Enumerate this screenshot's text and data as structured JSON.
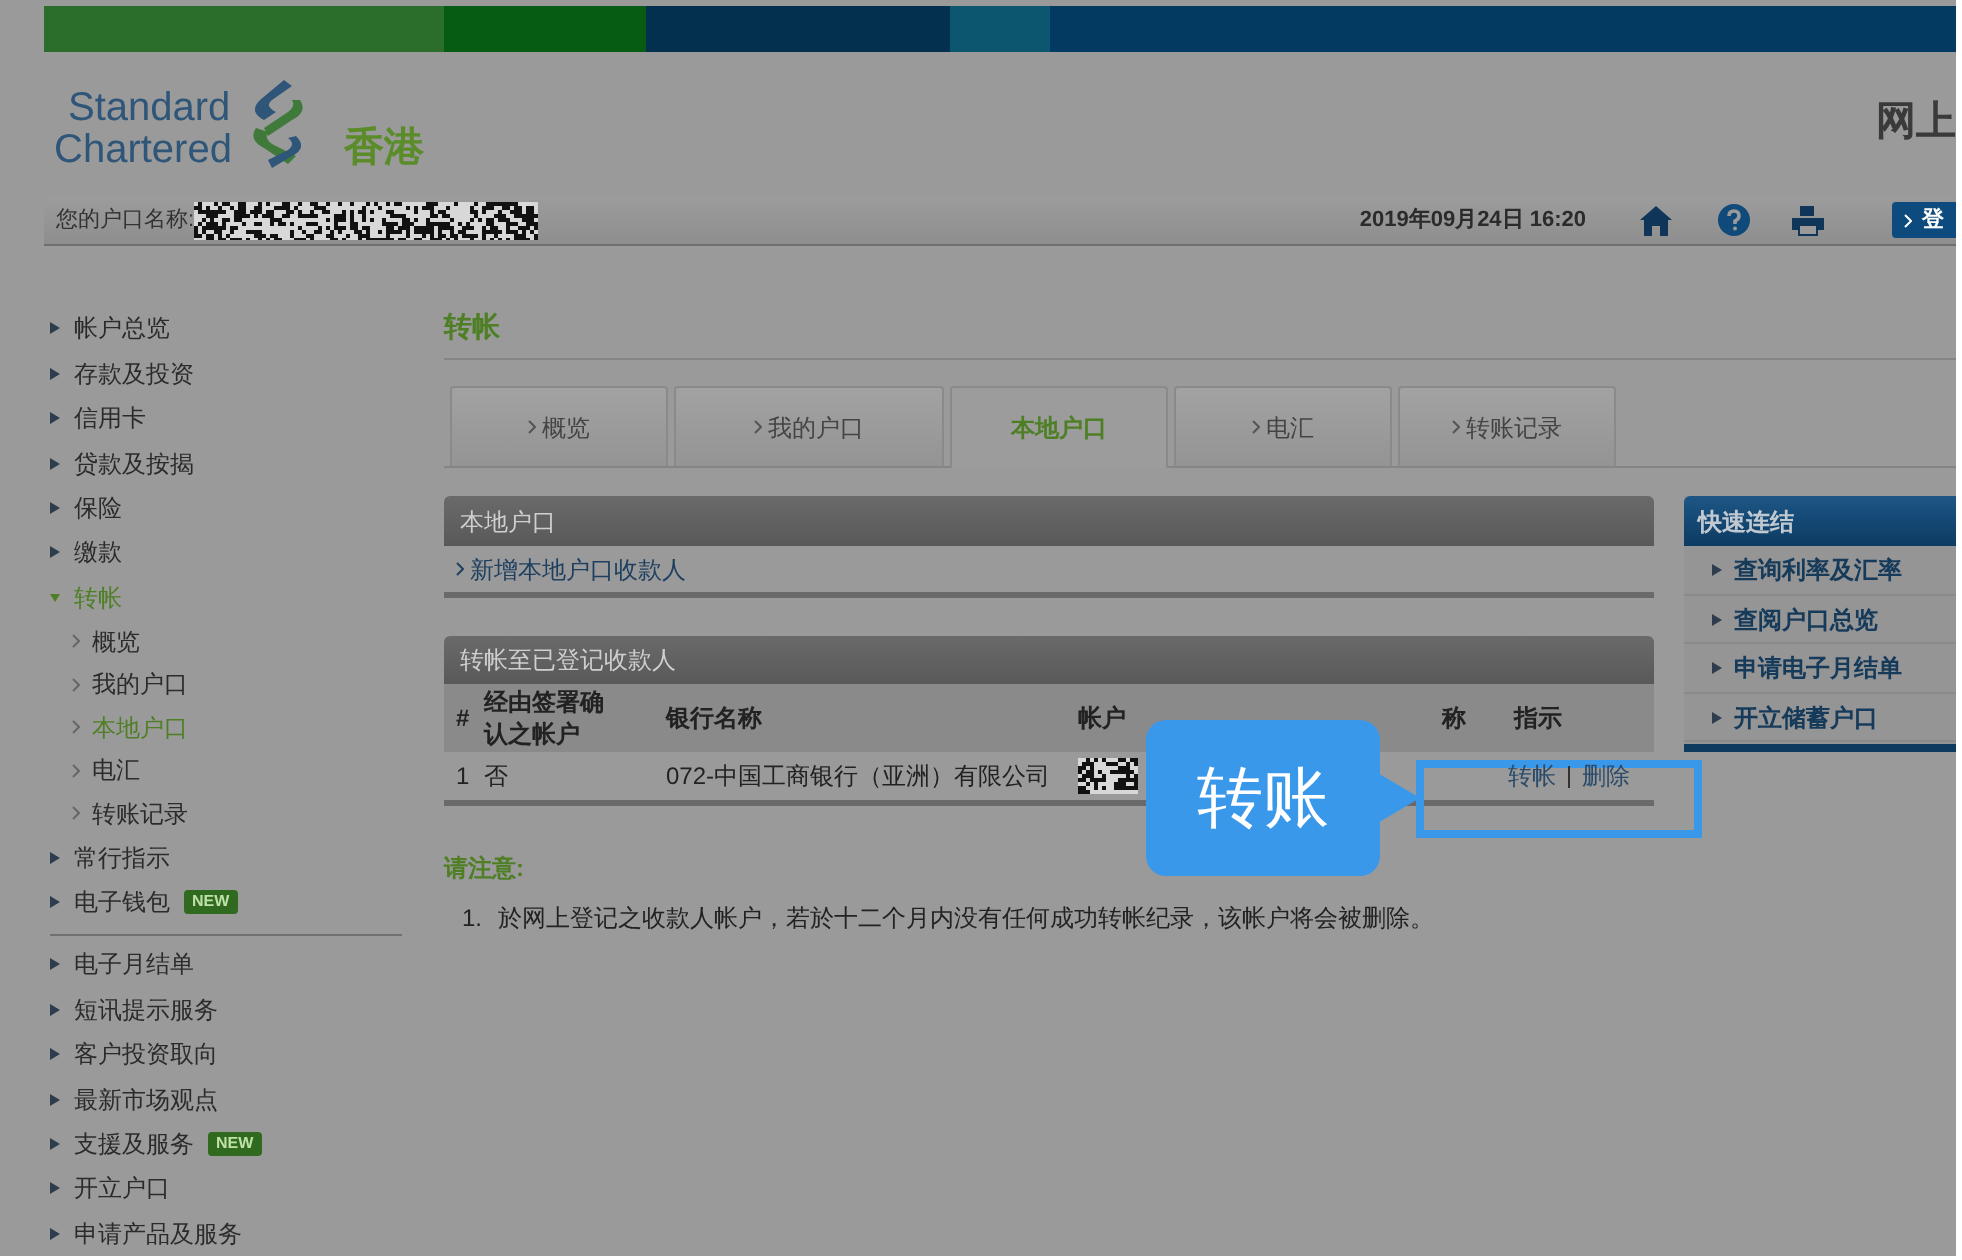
{
  "logo": {
    "line1": "Standard",
    "line2": "Chartered",
    "region": "香港"
  },
  "header_title": "网上",
  "account_bar": {
    "label": "您的户口名称:",
    "datetime": "2019年09月24日 16:20",
    "login_button": "登"
  },
  "sidebar": {
    "sections": [
      [
        {
          "label": "帐户总览",
          "expanded": false
        },
        {
          "label": "存款及投资",
          "expanded": false
        },
        {
          "label": "信用卡",
          "expanded": false
        },
        {
          "label": "贷款及按揭",
          "expanded": false
        },
        {
          "label": "保险",
          "expanded": false
        },
        {
          "label": "缴款",
          "expanded": false
        },
        {
          "label": "转帐",
          "expanded": true,
          "children": [
            {
              "label": "概览",
              "selected": false
            },
            {
              "label": "我的户口",
              "selected": false
            },
            {
              "label": "本地户口",
              "selected": true
            },
            {
              "label": "电汇",
              "selected": false
            },
            {
              "label": "转账记录",
              "selected": false
            }
          ]
        },
        {
          "label": "常行指示",
          "expanded": false
        },
        {
          "label": "电子钱包",
          "expanded": false,
          "badge": "NEW"
        }
      ],
      [
        {
          "label": "电子月结单",
          "expanded": false
        },
        {
          "label": "短讯提示服务",
          "expanded": false
        },
        {
          "label": "客户投资取向",
          "expanded": false
        },
        {
          "label": "最新市场观点",
          "expanded": false
        },
        {
          "label": "支援及服务",
          "expanded": false,
          "badge": "NEW"
        },
        {
          "label": "开立户口",
          "expanded": false
        },
        {
          "label": "申请产品及服务",
          "expanded": false
        }
      ]
    ]
  },
  "page_title": "转帐",
  "tabs": [
    {
      "label": "概览",
      "selected": false
    },
    {
      "label": "我的户口",
      "selected": false
    },
    {
      "label": "本地户口",
      "selected": true
    },
    {
      "label": "电汇",
      "selected": false
    },
    {
      "label": "转账记录",
      "selected": false
    }
  ],
  "local_account_panel": {
    "title": "本地户口",
    "link": "新增本地户口收款人"
  },
  "payees_panel": {
    "title": "转帐至已登记收款人",
    "columns": [
      "#",
      "经由签署确认之帐户",
      "银行名称",
      "帐户",
      "称",
      "指示"
    ],
    "rows": [
      {
        "number": "1",
        "signed": "否",
        "bank": "072-中国工商银行（亚洲）有限公司",
        "actions": [
          "转帐",
          "删除"
        ]
      }
    ]
  },
  "notice": {
    "title": "请注意:",
    "items": [
      {
        "number": "1.",
        "text": "於网上登记之收款人帐户，若於十二个月内没有任何成功转帐纪录，该帐户将会被删除。"
      }
    ]
  },
  "quick_links": {
    "title": "快速连结",
    "items": [
      "查询利率及汇率",
      "查阅户口总览",
      "申请电子月结单",
      "开立储蓄户口"
    ]
  },
  "callout": {
    "label": "转账"
  }
}
